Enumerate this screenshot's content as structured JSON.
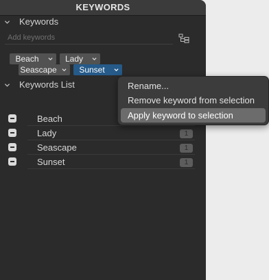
{
  "panel": {
    "title": "KEYWORDS"
  },
  "keywords_section": {
    "title": "Keywords",
    "add_placeholder": "Add keywords",
    "tags": [
      {
        "label": "Beach",
        "selected": false
      },
      {
        "label": "Lady",
        "selected": false
      },
      {
        "label": "Seascape",
        "selected": false
      },
      {
        "label": "Sunset",
        "selected": true
      }
    ]
  },
  "list_section": {
    "title": "Keywords List",
    "items": [
      {
        "label": "Beach",
        "count": ""
      },
      {
        "label": "Lady",
        "count": "1"
      },
      {
        "label": "Seascape",
        "count": "1"
      },
      {
        "label": "Sunset",
        "count": "1"
      }
    ]
  },
  "context_menu": {
    "items": [
      {
        "label": "Rename..."
      },
      {
        "label": "Remove keyword from selection"
      },
      {
        "label": "Apply keyword to selection"
      }
    ],
    "highlighted_index": 2
  },
  "colors": {
    "panel_bg": "#2b2b2b",
    "selected_tag": "#255a89",
    "menu_highlight": "#6c6c6c"
  },
  "icons": [
    "chevron-down-icon",
    "keyword-tree-icon",
    "checkbox-minus-icon"
  ]
}
